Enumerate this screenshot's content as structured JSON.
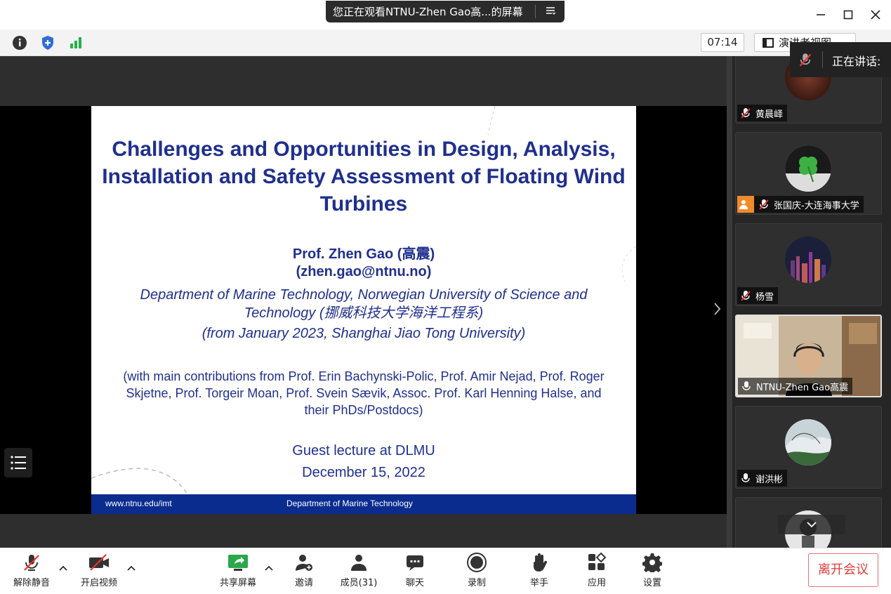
{
  "titlebar": {
    "share_banner": "您正在观看NTNU-Zhen Gao高...的屏幕",
    "share_menu_icon": "list-menu-icon",
    "minimize_icon": "minimize-icon",
    "maximize_icon": "maximize-icon",
    "close_icon": "close-icon"
  },
  "toolbar": {
    "info_icon": "info-icon",
    "security_icon": "shield-icon",
    "signal_icon": "signal-bars-icon",
    "timer": "07:14",
    "view_mode": "演讲者视图",
    "fullscreen_icon": "fullscreen-icon"
  },
  "speaking": {
    "label": "正在讲话:"
  },
  "slide": {
    "title": "Challenges and Opportunities in Design, Analysis, Installation and Safety Assessment of Floating Wind Turbines",
    "author": "Prof. Zhen Gao (高震)",
    "email": "(zhen.gao@ntnu.no)",
    "department": "Department of Marine Technology, Norwegian University of Science and Technology (挪威科技大学海洋工程系)",
    "from": "(from January 2023, Shanghai Jiao Tong University)",
    "contributions": "(with main contributions from Prof. Erin Bachynski-Polic, Prof. Amir Nejad, Prof. Roger Skjetne, Prof. Torgeir Moan, Prof. Svein Sævik, Assoc. Prof. Karl Henning Halse, and their PhDs/Postdocs)",
    "guest": "Guest lecture at DLMU",
    "date": "December 15, 2022",
    "footer_url": "www.ntnu.edu/imt",
    "footer_dept": "Department of Marine Technology"
  },
  "participants": [
    {
      "name": "黄晨峄",
      "mic": "muted",
      "avatar": "photo-avatar"
    },
    {
      "name": "张国庆-大连海事大学",
      "mic": "muted",
      "avatar": "clover-avatar",
      "host_badge": "person-icon"
    },
    {
      "name": "杨雪",
      "mic": "muted",
      "avatar": "city-night-avatar"
    },
    {
      "name": "NTNU-Zhen Gao高震",
      "mic": "on",
      "avatar": "video-feed",
      "active": true
    },
    {
      "name": "谢洪彬",
      "mic": "on",
      "avatar": "landscape-avatar"
    },
    {
      "name": "",
      "mic": "",
      "avatar": "character-avatar"
    }
  ],
  "bottombar": {
    "unmute": "解除静音",
    "start_video": "开启视频",
    "share_screen": "共享屏幕",
    "invite": "邀请",
    "members": "成员(31)",
    "chat": "聊天",
    "record": "录制",
    "raise_hand": "举手",
    "apps": "应用",
    "settings": "设置",
    "leave": "离开会议"
  },
  "colors": {
    "slide_blue": "#1f2f8e",
    "footer_blue": "#0a2c8f",
    "leave_red": "#e03a3a",
    "share_green": "#2aa84a"
  }
}
